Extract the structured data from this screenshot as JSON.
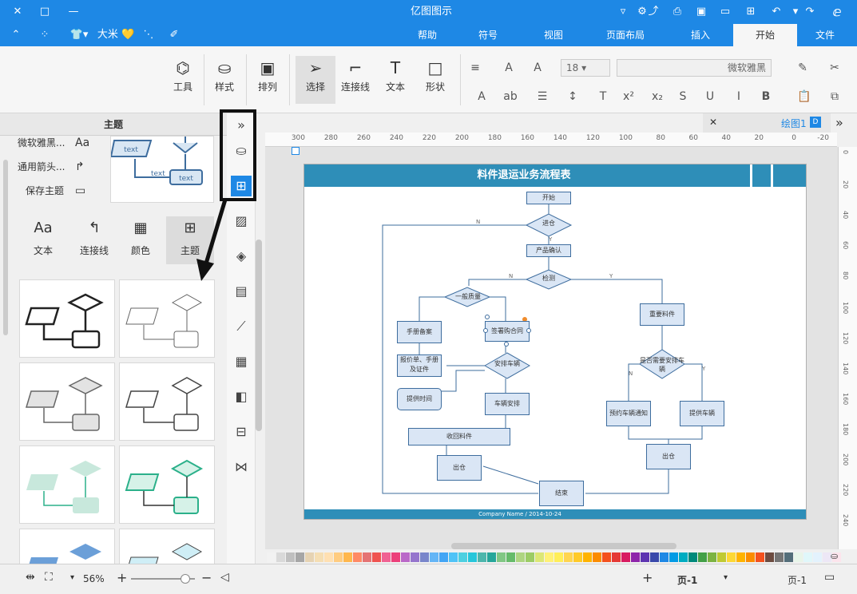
{
  "app_title": "亿图图示",
  "menu_tabs": [
    "文件",
    "开始",
    "插入",
    "页面布局",
    "视图",
    "符号",
    "帮助"
  ],
  "user": "大米",
  "ribbon": {
    "font_name": "微软雅黑",
    "font_size": "18",
    "buttons": [
      "形状",
      "文本",
      "连接线",
      "选择",
      "排列",
      "样式",
      "工具"
    ]
  },
  "left_panel": {
    "title": "主题",
    "items": [
      "微软雅黑...",
      "通用箭头...",
      "保存主题"
    ],
    "item_icons": [
      "Aa",
      "↱",
      "▭"
    ],
    "tabs": [
      "主题",
      "颜色",
      "连接线",
      "文本"
    ],
    "tab_icons": [
      "⊞",
      "▦",
      "↰",
      "Aa"
    ],
    "preview_text": "text"
  },
  "doc_tab": "绘图1",
  "ruler_h": [
    "-20",
    "0",
    "20",
    "40",
    "60",
    "80",
    "100",
    "120",
    "140",
    "160",
    "180",
    "200",
    "220",
    "240",
    "260",
    "280",
    "300"
  ],
  "ruler_v": [
    "0",
    "20",
    "40",
    "60",
    "80",
    "100",
    "120",
    "140",
    "160",
    "180",
    "200",
    "220",
    "240"
  ],
  "diagram": {
    "title": "料件退运业务流程表",
    "footer": "Company Name / 2014-10-24",
    "nodes": {
      "start": "开始",
      "receive": "进仓",
      "product": "产品确认",
      "check": "检测",
      "normal": "一般质量",
      "major": "重要料件",
      "rework": "手册备案",
      "contract": "签署购合同",
      "docs": "报价单、手册及证件",
      "arrange": "安排车辆",
      "decide": "是否需要安排车辆",
      "car": "车辆安排",
      "notify": "提供时间",
      "return": "收回料件",
      "ship": "出仓",
      "self": "提供车辆",
      "notify2": "预约车辆通知",
      "out2": "出仓",
      "end": "结束"
    },
    "labels": {
      "n": "N",
      "y": "Y"
    }
  },
  "colors": {
    "accent": "#1e88e5",
    "title_bar": "#2e8eb8",
    "shape_fill": "#dae6f5",
    "shape_stroke": "#3e6d9e"
  },
  "palette": [
    "#f2f2f2",
    "#d9d9d9",
    "#bfbfbf",
    "#a6a6a6",
    "#e6d3b3",
    "#f5deb3",
    "#ffe0b2",
    "#ffcc80",
    "#ffb74d",
    "#ff8a65",
    "#e57373",
    "#ef5350",
    "#f06292",
    "#ec407a",
    "#ba68c8",
    "#9575cd",
    "#7986cb",
    "#64b5f6",
    "#42a5f5",
    "#4fc3f7",
    "#4dd0e1",
    "#26c6da",
    "#4db6ac",
    "#26a69a",
    "#81c784",
    "#66bb6a",
    "#aed581",
    "#9ccc65",
    "#dce775",
    "#fff176",
    "#ffee58",
    "#ffd54f",
    "#ffca28",
    "#ffb300",
    "#fb8c00",
    "#f4511e",
    "#e53935",
    "#d81b60",
    "#8e24aa",
    "#5e35b1",
    "#3949ab",
    "#1e88e5",
    "#039be5",
    "#00acc1",
    "#00897b",
    "#43a047",
    "#7cb342",
    "#c0ca33",
    "#fdd835",
    "#ffb300",
    "#fb8c00",
    "#f4511e",
    "#6d4c41",
    "#757575",
    "#546e7a",
    "#e8f5e9",
    "#e0f7fa",
    "#e3f2fd",
    "#ede7f6",
    "#fce4ec"
  ],
  "status": {
    "page_label": "页-1",
    "page_tab": "页-1",
    "zoom": "56%"
  }
}
